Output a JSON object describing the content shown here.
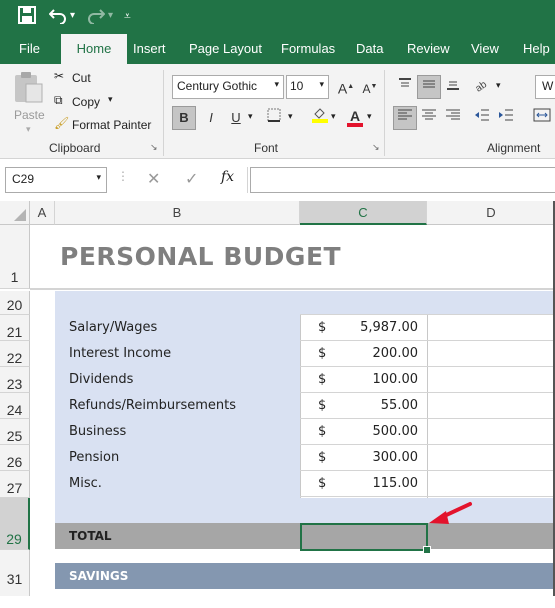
{
  "quick_access": {
    "save_icon": "save-icon",
    "undo_icon": "undo-icon",
    "redo_icon": "redo-icon",
    "customize_icon": "customize-icon"
  },
  "tabs": [
    "File",
    "Home",
    "Insert",
    "Page Layout",
    "Formulas",
    "Data",
    "Review",
    "View",
    "Help"
  ],
  "active_tab": "Home",
  "clipboard": {
    "paste": "Paste",
    "cut": "Cut",
    "copy": "Copy",
    "format_painter": "Format Painter",
    "group": "Clipboard"
  },
  "font": {
    "name": "Century Gothic",
    "size": "10",
    "bold": "B",
    "italic": "I",
    "underline": "U",
    "group": "Font"
  },
  "alignment": {
    "group": "Alignment",
    "wrap_partial": "W"
  },
  "formula_bar": {
    "name_box": "C29",
    "fx": "fx",
    "value": ""
  },
  "columns": [
    "A",
    "B",
    "C",
    "D"
  ],
  "rows": [
    "1",
    "20",
    "21",
    "22",
    "23",
    "24",
    "25",
    "26",
    "27",
    "29",
    "31"
  ],
  "sheet": {
    "title": "PERSONAL BUDGET",
    "income": [
      {
        "label": "Salary/Wages",
        "currency": "$",
        "amount": "5,987.00"
      },
      {
        "label": "Interest Income",
        "currency": "$",
        "amount": "200.00"
      },
      {
        "label": "Dividends",
        "currency": "$",
        "amount": "100.00"
      },
      {
        "label": "Refunds/Reimbursements",
        "currency": "$",
        "amount": "55.00"
      },
      {
        "label": "Business",
        "currency": "$",
        "amount": "500.00"
      },
      {
        "label": "Pension",
        "currency": "$",
        "amount": "300.00"
      },
      {
        "label": "Misc.",
        "currency": "$",
        "amount": "115.00"
      }
    ],
    "total_label": "TOTAL",
    "savings_label": "SAVINGS"
  },
  "colors": {
    "excel_green": "#217346",
    "title_gray": "#7f7f7f",
    "band_blue": "#d9e1f2",
    "total_gray": "#a6a6a6",
    "savings_blue": "#8497b0",
    "arrow_red": "#e3132c"
  }
}
